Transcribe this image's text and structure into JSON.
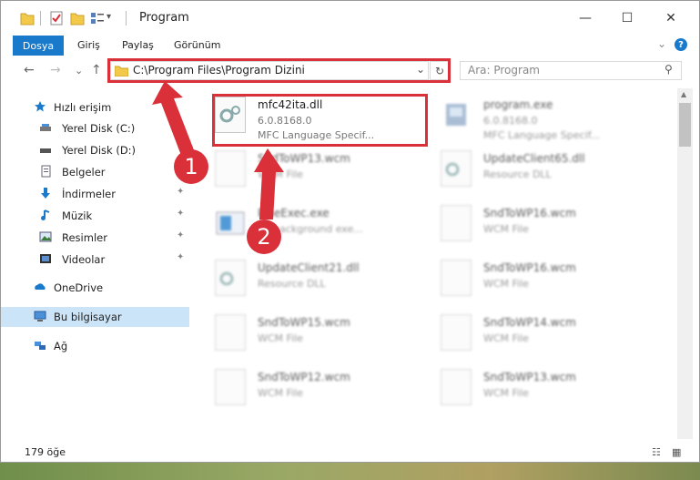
{
  "window": {
    "title": "Program",
    "min_glyph": "—",
    "max_glyph": "☐",
    "close_glyph": "✕"
  },
  "ribbon": {
    "tabs": [
      "Dosya",
      "Giriş",
      "Paylaş",
      "Görünüm"
    ],
    "collapse_glyph": "⌄",
    "help_glyph": "?"
  },
  "nav": {
    "back_glyph": "←",
    "forward_glyph": "→",
    "recent_glyph": "⌄",
    "up_glyph": "↑",
    "address": "C:\\Program Files\\Program Dizini",
    "address_dropdown_glyph": "⌄",
    "refresh_glyph": "↻",
    "search_placeholder": "Ara: Program",
    "search_glyph": "⚲"
  },
  "sidebar": {
    "items": [
      {
        "label": "Hızlı erişim",
        "icon": "star-icon",
        "pinned": false
      },
      {
        "label": "Yerel Disk (C:)",
        "icon": "drive-icon",
        "pinned": true
      },
      {
        "label": "Yerel Disk (D:)",
        "icon": "drive-icon",
        "pinned": true
      },
      {
        "label": "Belgeler",
        "icon": "documents-icon",
        "pinned": true
      },
      {
        "label": "İndirmeler",
        "icon": "download-icon",
        "pinned": true
      },
      {
        "label": "Müzik",
        "icon": "music-icon",
        "pinned": true
      },
      {
        "label": "Resimler",
        "icon": "pictures-icon",
        "pinned": true
      },
      {
        "label": "Videolar",
        "icon": "videos-icon",
        "pinned": true
      },
      {
        "label": "OneDrive",
        "icon": "cloud-icon",
        "pinned": false
      },
      {
        "label": "Bu bilgisayar",
        "icon": "computer-icon",
        "pinned": false,
        "selected": true
      },
      {
        "label": "Ağ",
        "icon": "network-icon",
        "pinned": false
      }
    ],
    "pin_glyph": "📌"
  },
  "files": [
    {
      "name": "mfc42ita.dll",
      "line1": "6.0.8168.0",
      "line2": "MFC Language Specif...",
      "icon": "dll-gear-icon",
      "highlighted": true
    },
    {
      "name": "program.exe",
      "line1": "6.0.8168.0",
      "line2": "MFC Language Specif...",
      "icon": "exe-icon"
    },
    {
      "name": "SndToWP13.wcm",
      "line1": "WCM File",
      "line2": "",
      "icon": "document-icon"
    },
    {
      "name": "UpdateClient65.dll",
      "line1": "Resource DLL",
      "line2": "",
      "icon": "dll-gear-icon"
    },
    {
      "name": "PineExec.exe",
      "line1": "BY background exe...",
      "line2": "",
      "icon": "app-window-icon"
    },
    {
      "name": "SndToWP16.wcm",
      "line1": "WCM File",
      "line2": "",
      "icon": "document-icon"
    },
    {
      "name": "UpdateClient21.dll",
      "line1": "Resource DLL",
      "line2": "",
      "icon": "dll-gear-icon"
    },
    {
      "name": "SndToWP16.wcm",
      "line1": "WCM File",
      "line2": "",
      "icon": "document-icon"
    },
    {
      "name": "SndToWP15.wcm",
      "line1": "WCM File",
      "line2": "",
      "icon": "document-icon"
    },
    {
      "name": "SndToWP14.wcm",
      "line1": "WCM File",
      "line2": "",
      "icon": "document-icon"
    },
    {
      "name": "SndToWP12.wcm",
      "line1": "WCM File",
      "line2": "",
      "icon": "document-icon"
    },
    {
      "name": "SndToWP13.wcm",
      "line1": "WCM File",
      "line2": "",
      "icon": "document-icon"
    }
  ],
  "status": {
    "item_count": "179 öğe",
    "details_view_glyph": "☷",
    "icons_view_glyph": "▦"
  },
  "annotations": {
    "step1": "1",
    "step2": "2",
    "color": "#d9303a"
  },
  "colors": {
    "accent": "#1979ca",
    "selection": "#cce4f7",
    "highlight": "#d9303a"
  }
}
